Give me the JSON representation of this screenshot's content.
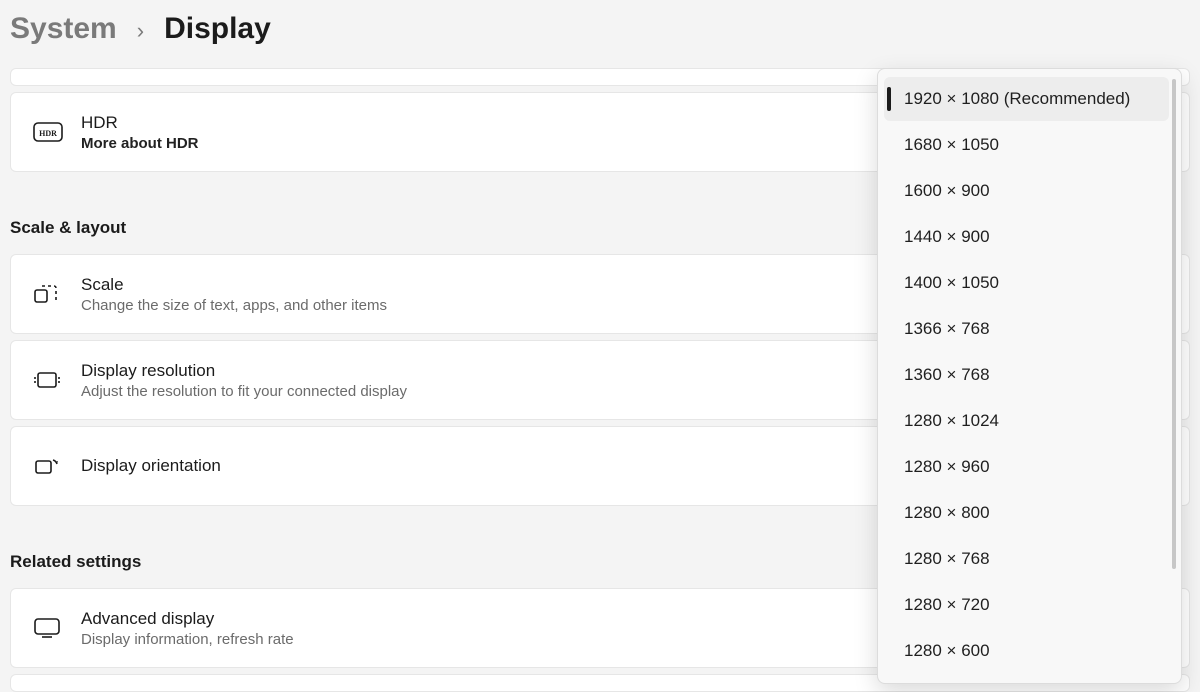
{
  "breadcrumb": {
    "parent": "System",
    "current": "Display"
  },
  "hdr": {
    "title": "HDR",
    "sub": "More about HDR"
  },
  "sections": {
    "scale_layout": "Scale & layout",
    "related": "Related settings"
  },
  "scale": {
    "title": "Scale",
    "sub": "Change the size of text, apps, and other items"
  },
  "resolution": {
    "title": "Display resolution",
    "sub": "Adjust the resolution to fit your connected display"
  },
  "orientation": {
    "title": "Display orientation"
  },
  "advanced": {
    "title": "Advanced display",
    "sub": "Display information, refresh rate"
  },
  "resolution_options": [
    {
      "label": "1920 × 1080 (Recommended)",
      "selected": true
    },
    {
      "label": "1680 × 1050",
      "selected": false
    },
    {
      "label": "1600 × 900",
      "selected": false
    },
    {
      "label": "1440 × 900",
      "selected": false
    },
    {
      "label": "1400 × 1050",
      "selected": false
    },
    {
      "label": "1366 × 768",
      "selected": false
    },
    {
      "label": "1360 × 768",
      "selected": false
    },
    {
      "label": "1280 × 1024",
      "selected": false
    },
    {
      "label": "1280 × 960",
      "selected": false
    },
    {
      "label": "1280 × 800",
      "selected": false
    },
    {
      "label": "1280 × 768",
      "selected": false
    },
    {
      "label": "1280 × 720",
      "selected": false
    },
    {
      "label": "1280 × 600",
      "selected": false
    }
  ]
}
